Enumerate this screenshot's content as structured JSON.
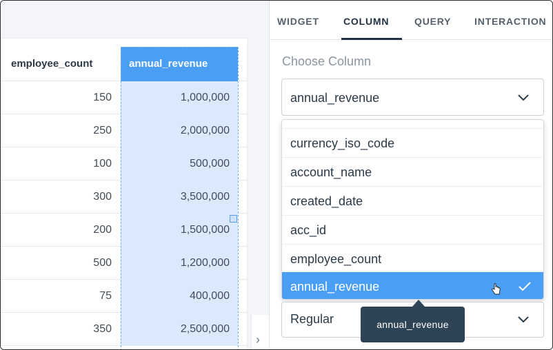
{
  "table": {
    "headers": {
      "employee_count": "employee_count",
      "annual_revenue": "annual_revenue"
    },
    "rows": [
      {
        "employee_count": "150",
        "annual_revenue": "1,000,000"
      },
      {
        "employee_count": "250",
        "annual_revenue": "2,000,000"
      },
      {
        "employee_count": "100",
        "annual_revenue": "500,000"
      },
      {
        "employee_count": "300",
        "annual_revenue": "3,500,000"
      },
      {
        "employee_count": "200",
        "annual_revenue": "1,500,000"
      },
      {
        "employee_count": "500",
        "annual_revenue": "1,200,000"
      },
      {
        "employee_count": "75",
        "annual_revenue": "400,000"
      },
      {
        "employee_count": "350",
        "annual_revenue": "2,500,000"
      }
    ]
  },
  "panel": {
    "tabs": [
      "WIDGET",
      "COLUMN",
      "QUERY",
      "INTERACTION"
    ],
    "active_tab": "COLUMN",
    "choose_column_label": "Choose Column",
    "selected_column": "annual_revenue",
    "dropdown_options": [
      "currency_iso_code",
      "account_name",
      "created_date",
      "acc_id",
      "employee_count",
      "annual_revenue"
    ],
    "format_select_value": "Regular",
    "tooltip": "annual_revenue"
  },
  "colors": {
    "accent": "#4a9ff5",
    "selected_column_bg": "#dbe9fc",
    "tooltip_bg": "#2e4356",
    "text_dark": "#2b3a48"
  },
  "icons": {
    "dropdown_chevron": "chevron-down-icon",
    "selected_check": "check-icon",
    "panel_toggle": "chevron-right-icon",
    "pointer": "hand-cursor-icon"
  }
}
